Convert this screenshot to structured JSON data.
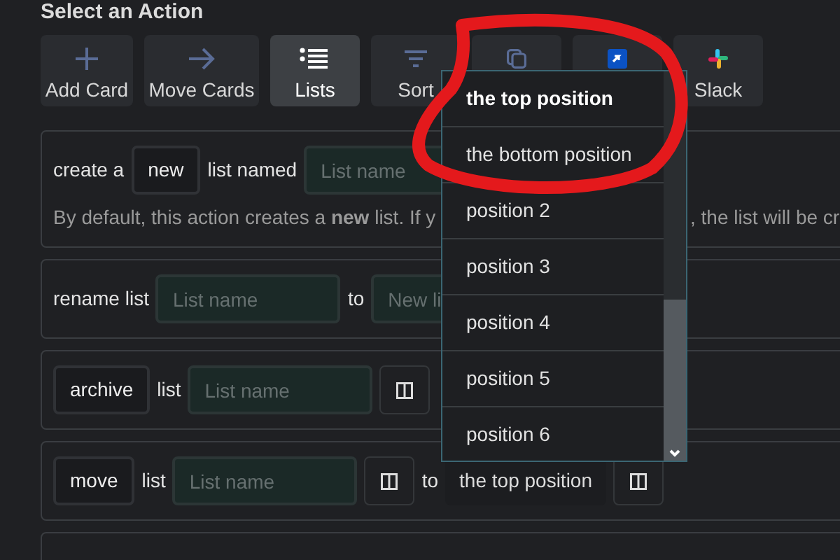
{
  "title": "Select an Action",
  "actions": [
    {
      "label": "Add Card",
      "selected": false
    },
    {
      "label": "Move Cards",
      "selected": false
    },
    {
      "label": "Lists",
      "selected": true
    },
    {
      "label": "Sort",
      "selected": false
    },
    {
      "selected": false
    },
    {
      "selected": false
    },
    {
      "label": "Slack",
      "selected": false
    }
  ],
  "rows": [
    {
      "parts": [
        {
          "kind": "text",
          "text": "create a"
        },
        {
          "kind": "button",
          "text": "new"
        },
        {
          "kind": "text",
          "text": "list named"
        },
        {
          "kind": "input",
          "placeholder": "List name"
        }
      ],
      "note": [
        "By default, this action creates a **new** list. If y",
        ", the list will be cr"
      ]
    },
    {
      "parts": [
        {
          "kind": "text",
          "text": "rename list"
        },
        {
          "kind": "input",
          "placeholder": "List name"
        },
        {
          "kind": "text",
          "text": "to"
        },
        {
          "kind": "input",
          "placeholder": "New li"
        }
      ]
    },
    {
      "parts": [
        {
          "kind": "button",
          "text": "archive"
        },
        {
          "kind": "text",
          "text": "list"
        },
        {
          "kind": "input",
          "placeholder": "List name"
        },
        {
          "kind": "icon_button"
        }
      ]
    },
    {
      "parts": [
        {
          "kind": "button",
          "text": "move"
        },
        {
          "kind": "text",
          "text": "list"
        },
        {
          "kind": "input",
          "placeholder": "List name"
        },
        {
          "kind": "icon_button"
        },
        {
          "kind": "text",
          "text": "to"
        },
        {
          "kind": "select",
          "value": "the top position"
        },
        {
          "kind": "icon_button"
        }
      ]
    }
  ],
  "dropdown": {
    "options": [
      {
        "label": "the top position",
        "selected": true
      },
      {
        "label": "the bottom position",
        "selected": false
      },
      {
        "label": "position 2",
        "selected": false
      },
      {
        "label": "position 3",
        "selected": false
      },
      {
        "label": "position 4",
        "selected": false
      },
      {
        "label": "position 5",
        "selected": false
      },
      {
        "label": "position 6",
        "selected": false
      }
    ]
  }
}
